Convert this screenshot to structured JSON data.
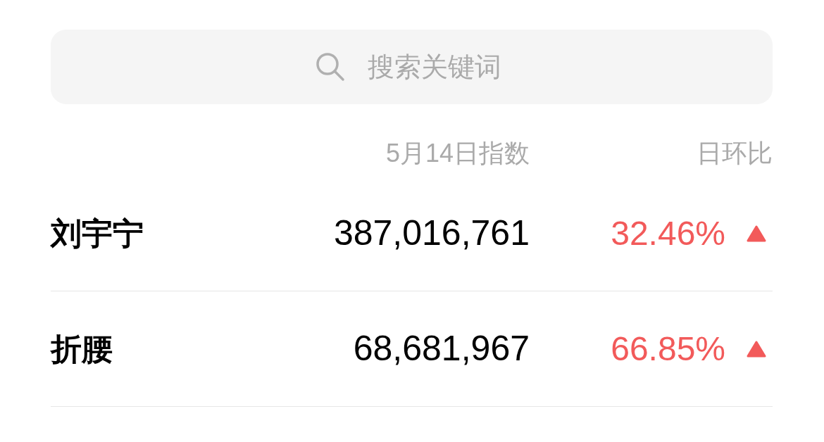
{
  "search": {
    "placeholder": "搜索关键词"
  },
  "table": {
    "columns": [
      "5月14日指数",
      "日环比"
    ],
    "rows": [
      {
        "name": "刘宇宁",
        "index": "387,016,761",
        "change": "32.46%",
        "rising": true
      },
      {
        "name": "折腰",
        "index": "68,681,967",
        "change": "66.85%",
        "rising": true
      }
    ]
  }
}
